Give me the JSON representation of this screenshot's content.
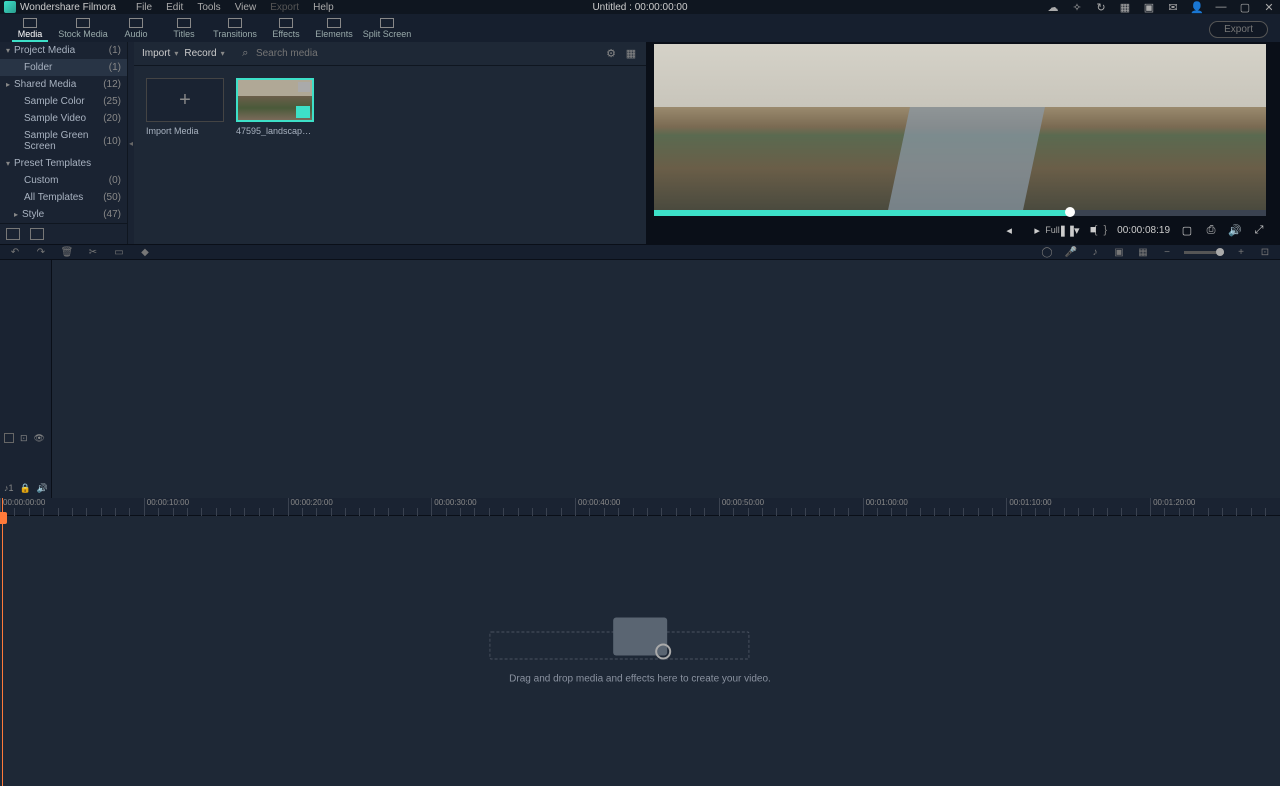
{
  "app": {
    "name": "Wondershare Filmora",
    "docTitle": "Untitled : 00:00:00:00"
  },
  "menu": {
    "file": "File",
    "edit": "Edit",
    "tools": "Tools",
    "view": "View",
    "export": "Export",
    "help": "Help"
  },
  "tabs": {
    "media": "Media",
    "stock": "Stock Media",
    "audio": "Audio",
    "titles": "Titles",
    "transitions": "Transitions",
    "effects": "Effects",
    "elements": "Elements",
    "split": "Split Screen",
    "exportBtn": "Export"
  },
  "sidebar": {
    "projectMedia": {
      "label": "Project Media",
      "count": "(1)"
    },
    "folder": {
      "label": "Folder",
      "count": "(1)"
    },
    "sharedMedia": {
      "label": "Shared Media",
      "count": "(12)"
    },
    "sampleColor": {
      "label": "Sample Color",
      "count": "(25)"
    },
    "sampleVideo": {
      "label": "Sample Video",
      "count": "(20)"
    },
    "sampleGreen": {
      "label": "Sample Green Screen",
      "count": "(10)"
    },
    "presetTemplates": {
      "label": "Preset Templates",
      "count": ""
    },
    "custom": {
      "label": "Custom",
      "count": "(0)"
    },
    "allTemplates": {
      "label": "All Templates",
      "count": "(50)"
    },
    "style": {
      "label": "Style",
      "count": "(47)"
    }
  },
  "mediaToolbar": {
    "import": "Import",
    "record": "Record",
    "searchPlaceholder": "Search media"
  },
  "mediaCards": {
    "importMedia": "Import Media",
    "clip1": "47595_landscape_of_..."
  },
  "preview": {
    "quality": "Full",
    "timecode": "00:00:08:19",
    "markerL": "{",
    "markerR": "}"
  },
  "timeline": {
    "ticks": [
      "00:00:00:00",
      "00:00:10:00",
      "00:00:20:00",
      "00:00:30:00",
      "00:00:40:00",
      "00:00:50:00",
      "00:01:00:00",
      "00:01:10:00",
      "00:01:20:00"
    ],
    "dropText": "Drag and drop media and effects here to create your video."
  }
}
